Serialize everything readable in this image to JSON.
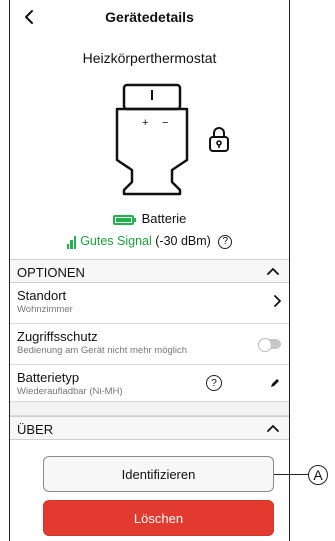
{
  "header": {
    "title": "Gerätedetails",
    "device_name": "Heizkörperthermostat"
  },
  "device": {
    "plus": "+",
    "minus": "−"
  },
  "status": {
    "battery_label": "Batterie",
    "signal_quality": "Gutes Signal",
    "signal_strength": "(-30 dBm)",
    "help_glyph": "?"
  },
  "sections": {
    "options": "OPTIONEN",
    "about": "ÜBER"
  },
  "rows": [
    {
      "title": "Standort",
      "subtitle": "Wohnzimmer"
    },
    {
      "title": "Zugriffsschutz",
      "subtitle": "Bedienung am Gerät nicht mehr möglich",
      "toggle_on": false
    },
    {
      "title": "Batterietyp",
      "subtitle": "Wiederaufladbar (Ni-MH)"
    }
  ],
  "buttons": {
    "identify": "Identifizieren",
    "delete": "Löschen"
  },
  "callout": "A",
  "colors": {
    "accent_green": "#22b14c",
    "delete_red": "#e23a2e"
  }
}
